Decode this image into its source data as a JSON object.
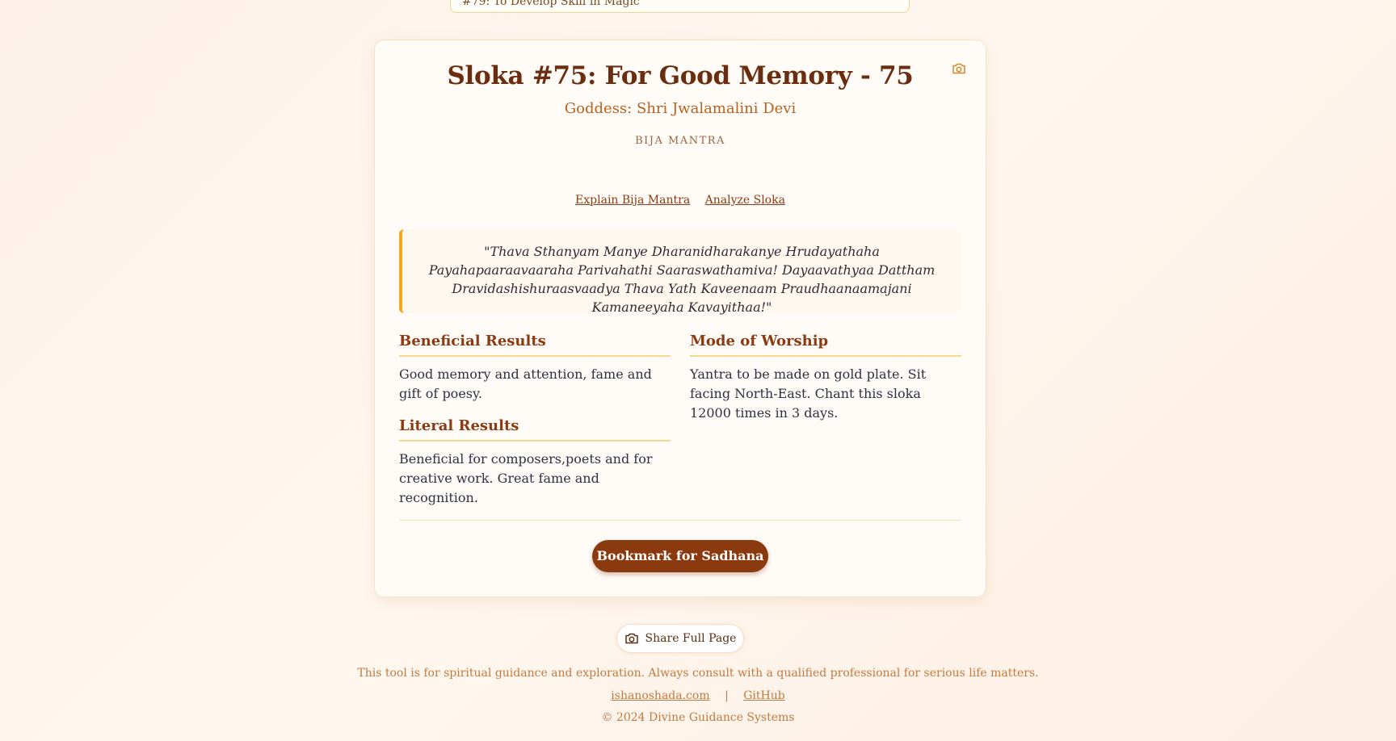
{
  "top_select": {
    "value": "#79: To Develop Skill in Magic"
  },
  "card": {
    "title": "Sloka #75: For Good Memory - 75",
    "goddess": "Goddess: Shri Jwalamalini Devi",
    "bija_label": "BIJA MANTRA",
    "links": {
      "explain": "Explain Bija Mantra",
      "analyze": "Analyze Sloka"
    },
    "quote": "\"Thava Sthanyam Manye Dharanidharakanye Hrudayathaha Payahapaaraavaaraha Parivahathi Saaraswathamiva! Dayaavathyaa Dattham Dravidashishuraasvaadya Thava Yath Kaveenaam Praudhaanaamajani Kamaneeyaha Kavayithaa!\"",
    "beneficial": {
      "heading": "Beneficial Results",
      "text": "Good memory and attention, fame and gift of poesy."
    },
    "literal": {
      "heading": "Literal Results",
      "text": "Beneficial for composers,poets and for creative work. Great fame and recognition."
    },
    "worship": {
      "heading": "Mode of Worship",
      "text": "Yantra to be made on gold plate. Sit facing North-East. Chant this sloka 12000 times in 3 days."
    },
    "bookmark_label": "Bookmark for Sadhana",
    "camera_icon": "camera-icon"
  },
  "share": {
    "label": "Share Full Page",
    "icon": "camera-icon"
  },
  "footer": {
    "disclaimer": "This tool is for spiritual guidance and exploration. Always consult with a qualified professional for serious life matters.",
    "link1": "ishanoshada.com",
    "separator": "|",
    "link2": "GitHub",
    "copyright": "© 2024 Divine Guidance Systems"
  },
  "colors": {
    "accent": "#8b3a0f",
    "title": "#6b2d0f",
    "gold": "#f2a81d",
    "muted": "#c27a3e"
  }
}
